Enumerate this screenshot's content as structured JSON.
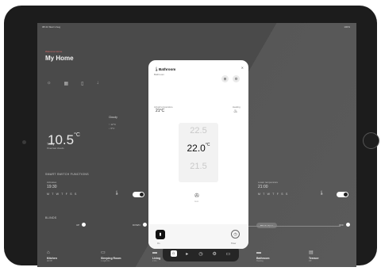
{
  "status_bar": {
    "time": "08:41",
    "date": "Wed 1 Aug",
    "battery": "100%"
  },
  "home": {
    "overline": "Welcome Home",
    "title": "My Home",
    "quick_icons": [
      "lightbulb-icon",
      "grid-icon",
      "door-icon",
      "download-icon"
    ],
    "outdoor_temp": "10.5",
    "outdoor_unit": "°C",
    "weather_label": "Cloudy",
    "weather_lines": [
      "↑ 12°C",
      "↓ 6°C"
    ],
    "forecast_label": "Today",
    "forecast_text": "Overcast clouds"
  },
  "schedule_left": {
    "section": "SMART SWITCH FUNCTIONS",
    "label": "Activates",
    "time": "19:30",
    "days": "M T W T F S S"
  },
  "schedule_right": {
    "label": "Lower temperature",
    "time": "21:00",
    "days": "M T W T F S S"
  },
  "blinds": {
    "section": "BLINDS",
    "left_label": "UP",
    "right_label": "DOWN",
    "slider_label": "Blinds Open",
    "right_end": "OFF"
  },
  "rooms": [
    {
      "name": "Kitchen",
      "sub": "All Off",
      "icon": "oven-icon"
    },
    {
      "name": "Sleeping Room",
      "sub": "1 Light On",
      "icon": "bed-icon"
    },
    {
      "name": "Living",
      "sub": "2 On",
      "icon": "sofa-icon"
    },
    {
      "name": "Bathroom",
      "sub": "Heating",
      "icon": "bath-icon"
    },
    {
      "name": "Terrace",
      "sub": "Off",
      "icon": "plant-icon"
    }
  ],
  "dock": [
    "home-icon",
    "scenes-icon",
    "clock-icon",
    "settings-icon",
    "more-icon"
  ],
  "modal": {
    "title": "Bathroom",
    "subtitle": "Bathroom",
    "actual_label": "Actual temperature",
    "actual_value": "21°C",
    "heating_label": "Heating",
    "picker_above": "22.5",
    "picker_selected": "22.0",
    "picker_unit": "°C",
    "picker_below": "21.5",
    "fan_label": "Auto",
    "on_label": "On",
    "timer_label": "Timer"
  }
}
